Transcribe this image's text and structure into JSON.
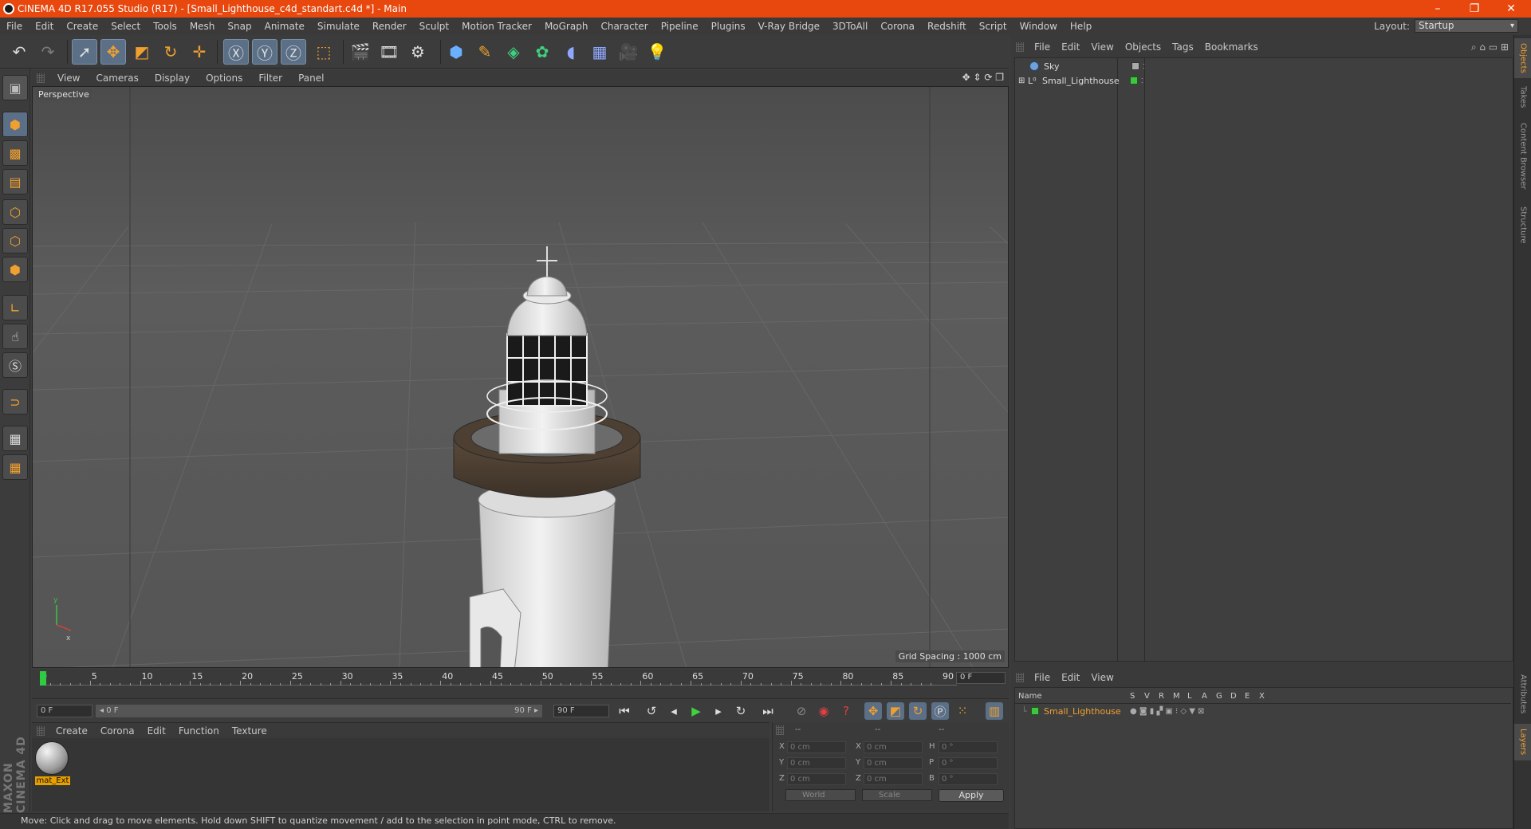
{
  "window": {
    "title": "CINEMA 4D R17.055 Studio (R17) - [Small_Lighthouse_c4d_standart.c4d *] - Main",
    "min": "–",
    "max": "❐",
    "close": "✕"
  },
  "menubar": [
    "File",
    "Edit",
    "Create",
    "Select",
    "Tools",
    "Mesh",
    "Snap",
    "Animate",
    "Simulate",
    "Render",
    "Sculpt",
    "Motion Tracker",
    "MoGraph",
    "Character",
    "Pipeline",
    "Plugins",
    "V-Ray Bridge",
    "3DToAll",
    "Corona",
    "Redshift",
    "Script",
    "Window",
    "Help"
  ],
  "layout": {
    "label": "Layout:",
    "value": "Startup"
  },
  "viewport": {
    "menu": [
      "View",
      "Cameras",
      "Display",
      "Options",
      "Filter",
      "Panel"
    ],
    "camera_label": "Perspective",
    "grid_spacing": "Grid Spacing : 1000 cm"
  },
  "timeline": {
    "ticks": [
      "0",
      "5",
      "10",
      "15",
      "20",
      "25",
      "30",
      "35",
      "40",
      "45",
      "50",
      "55",
      "60",
      "65",
      "70",
      "75",
      "80",
      "85",
      "90"
    ],
    "current_frame": "0 F",
    "start_frame": "0 F",
    "range_start": "◂ 0 F",
    "range_end": "90 F ▸",
    "end_frame": "90 F",
    "playhead_fraction": 0
  },
  "material_manager": {
    "menu": [
      "Create",
      "Corona",
      "Edit",
      "Function",
      "Texture"
    ],
    "materials": [
      {
        "name": "mat_Ext"
      }
    ]
  },
  "coordinates": {
    "headers": [
      "--",
      "--",
      "--"
    ],
    "rows": [
      {
        "a_label": "X",
        "a_val": "0 cm",
        "b_label": "X",
        "b_val": "0 cm",
        "c_label": "H",
        "c_val": "0 °"
      },
      {
        "a_label": "Y",
        "a_val": "0 cm",
        "b_label": "Y",
        "b_val": "0 cm",
        "c_label": "P",
        "c_val": "0 °"
      },
      {
        "a_label": "Z",
        "a_val": "0 cm",
        "b_label": "Z",
        "b_val": "0 cm",
        "c_label": "B",
        "c_val": "0 °"
      }
    ],
    "space": "World",
    "mode": "Scale",
    "apply": "Apply"
  },
  "status": "Move: Click and drag to move elements. Hold down SHIFT to quantize movement / add to the selection in point mode, CTRL to remove.",
  "object_manager": {
    "menu": [
      "File",
      "Edit",
      "View",
      "Objects",
      "Tags",
      "Bookmarks"
    ],
    "objects": [
      {
        "name": "Sky"
      },
      {
        "name": "Small_Lighthouse"
      }
    ]
  },
  "layer_manager": {
    "menu": [
      "File",
      "Edit",
      "View"
    ],
    "columns": [
      "Name",
      "S",
      "V",
      "R",
      "M",
      "L",
      "A",
      "G",
      "D",
      "E",
      "X"
    ],
    "layers": [
      {
        "name": "Small_Lighthouse"
      }
    ]
  },
  "side_tabs": [
    "Objects",
    "Takes",
    "Content Browser",
    "Structure",
    "Attributes",
    "Layers"
  ],
  "maxon": "MAXON CINEMA 4D",
  "colors": {
    "title_bar": "#e8470e",
    "accent": "#f0a030",
    "layer_green": "#3ec63e",
    "selected_icon": "#5b6f86"
  }
}
